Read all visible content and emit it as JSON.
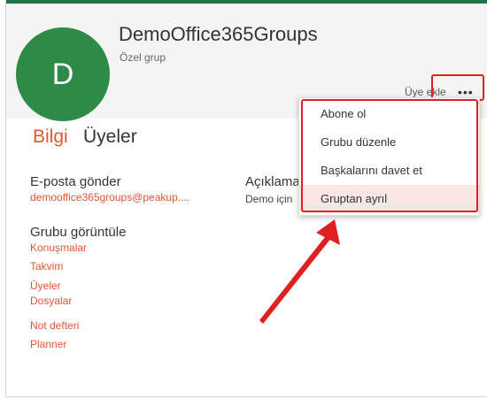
{
  "header": {
    "avatar_letter": "D",
    "group_name": "DemoOffice365Groups",
    "group_type": "Özel grup",
    "add_member_label": "Üye ekle",
    "more_icon": "more-horizontal-icon"
  },
  "tabs": [
    {
      "label": "Bilgi",
      "active": true
    },
    {
      "label": "Üyeler",
      "active": false
    }
  ],
  "email": {
    "heading": "E-posta gönder",
    "address": "demooffice365groups@peakup...."
  },
  "description": {
    "heading": "Açıklama",
    "text": "Demo için"
  },
  "view_group": {
    "heading": "Grubu görüntüle",
    "links": [
      "Konuşmalar",
      "Takvim",
      "Üyeler",
      "Dosyalar",
      "Not defteri",
      "Planner"
    ]
  },
  "menu": {
    "items": [
      {
        "label": "Abone ol"
      },
      {
        "label": "Grubu düzenle"
      },
      {
        "label": "Başkalarını davet et"
      },
      {
        "label": "Gruptan ayrıl",
        "hovered": true
      }
    ]
  },
  "colors": {
    "accent": "#e05533",
    "avatar": "#2e8b47",
    "brand_bar": "#217346",
    "annotation": "#e02020"
  }
}
